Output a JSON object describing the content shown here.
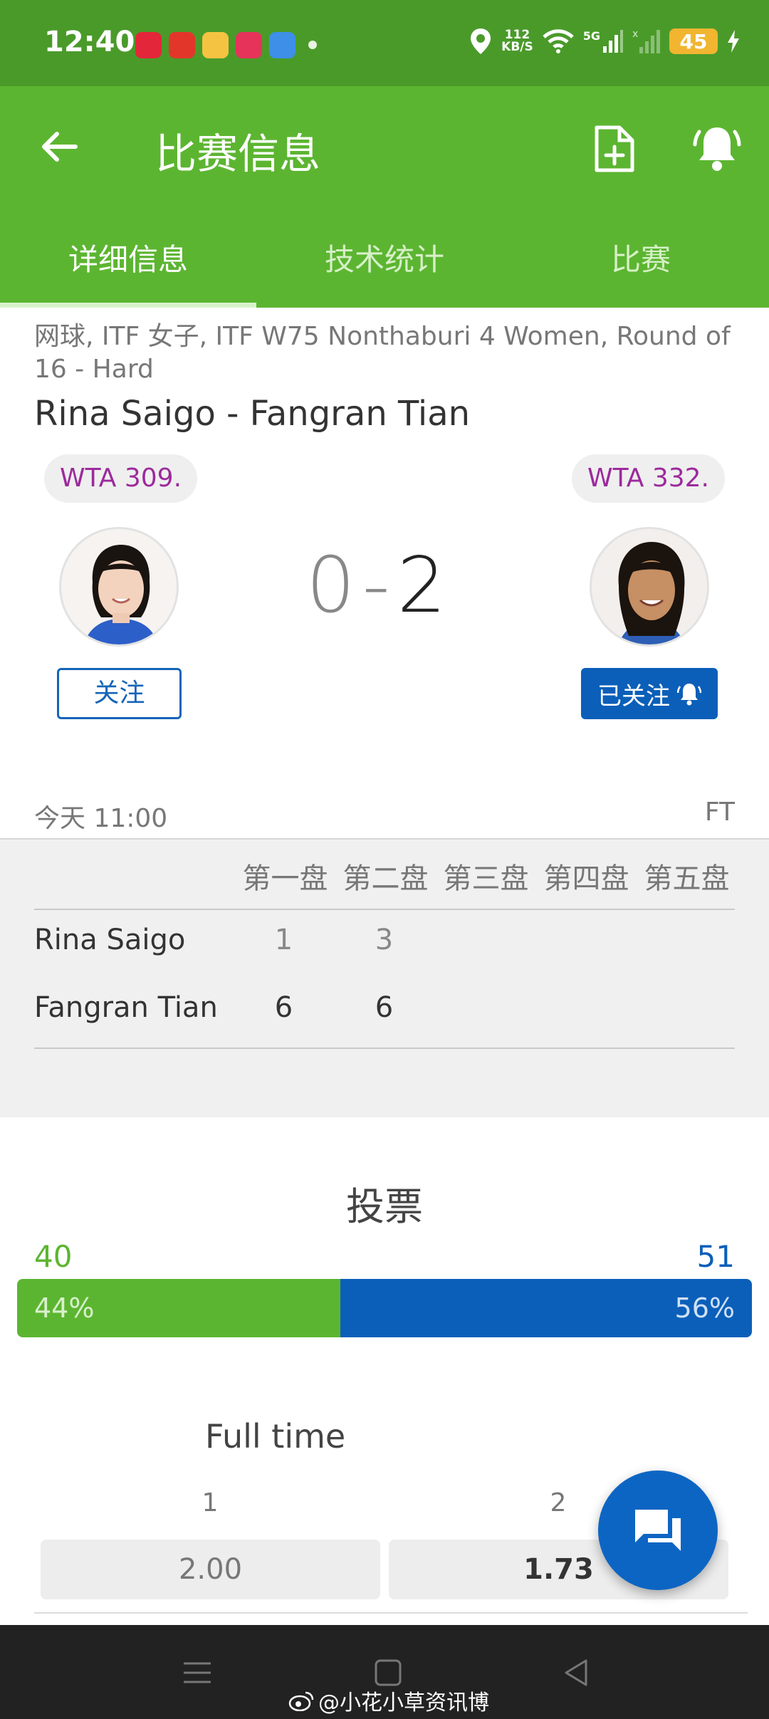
{
  "status_bar": {
    "time": "12:40",
    "network_speed": "112",
    "network_speed_unit": "KB/S",
    "network_type": "5G",
    "battery": "45",
    "app_icons": [
      "xiaohongshu-icon",
      "toutiao-icon",
      "weibo-icon",
      "app-icon",
      "browser-icon"
    ]
  },
  "appbar": {
    "title": "比赛信息",
    "icons": [
      "back-arrow-icon",
      "add-file-icon",
      "bell-icon"
    ]
  },
  "tabs": [
    {
      "label": "详细信息",
      "active": true
    },
    {
      "label": "技术统计",
      "active": false
    },
    {
      "label": "比赛",
      "active": false
    }
  ],
  "match": {
    "tournament": "网球, ITF 女子, ITF W75 Nonthaburi 4 Women, Round of 16 - Hard",
    "title": "Rina Saigo - Fangran Tian",
    "player1": {
      "name": "Rina Saigo",
      "rank": "WTA 309.",
      "follow_label": "关注"
    },
    "player2": {
      "name": "Fangran Tian",
      "rank": "WTA 332.",
      "follow_label": "已关注"
    },
    "score_home": "0",
    "score_sep": "-",
    "score_away": "2",
    "time": "今天 11:00",
    "status": "FT"
  },
  "sets": {
    "headers": [
      "第一盘",
      "第二盘",
      "第三盘",
      "第四盘",
      "第五盘"
    ],
    "rows": [
      {
        "name": "Rina Saigo",
        "values": [
          "1",
          "3"
        ]
      },
      {
        "name": "Fangran Tian",
        "values": [
          "6",
          "6"
        ]
      }
    ]
  },
  "vote": {
    "title": "投票",
    "left_count": "40",
    "right_count": "51",
    "left_pct_label": "44%",
    "right_pct_label": "56%",
    "left_fraction": 0.44,
    "colors": {
      "left": "#5cb531",
      "right": "#0b5fb9"
    }
  },
  "odds": {
    "title": "Full time",
    "label1": "1",
    "label2": "2",
    "value1": "2.00",
    "value2": "1.73"
  },
  "watermark": "@小花小草资讯博",
  "colors": {
    "header": "#5cb531",
    "status_bar": "#4a9a2a",
    "accent_blue": "#0b5fb9"
  }
}
